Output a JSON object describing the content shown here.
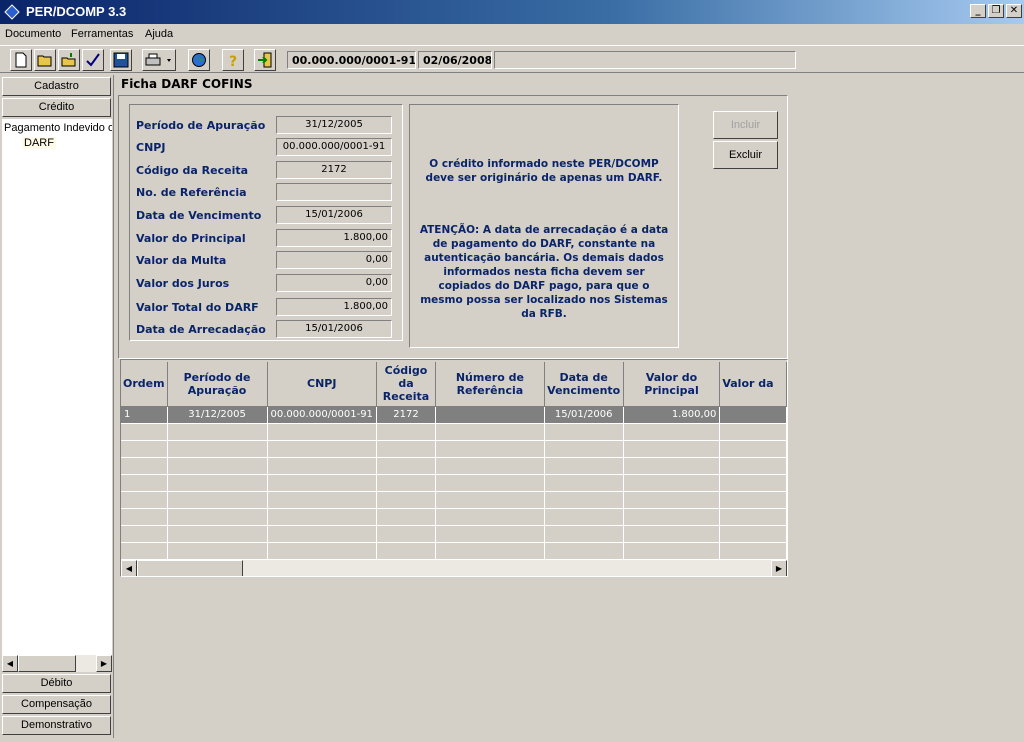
{
  "window": {
    "title": "PER/DCOMP 3.3",
    "min_label": "_",
    "restore_label": "❐",
    "close_label": "✕"
  },
  "menu": {
    "items": [
      "Documento",
      "Ferramentas",
      "Ajuda"
    ]
  },
  "toolbar": {
    "cnpj": "00.000.000/0001-91",
    "date": "02/06/2008",
    "status": ""
  },
  "sidebar": {
    "buttons_top": [
      "Cadastro",
      "Crédito"
    ],
    "tree_node": "Pagamento Indevido ou",
    "tree_child": "DARF",
    "buttons_bottom": [
      "Débito",
      "Compensação",
      "Demonstrativo"
    ]
  },
  "ficha": {
    "title": "Ficha DARF COFINS",
    "fields": [
      {
        "label": "Período de Apuração",
        "value": "31/12/2005",
        "align": "center"
      },
      {
        "label": "CNPJ",
        "value": "00.000.000/0001-91",
        "align": "center"
      },
      {
        "label": "Código da Receita",
        "value": "2172",
        "align": "center"
      },
      {
        "label": "No. de Referência",
        "value": "",
        "align": "center"
      },
      {
        "label": "Data de Vencimento",
        "value": "15/01/2006",
        "align": "center"
      },
      {
        "label": "Valor do Principal",
        "value": "1.800,00",
        "align": "right"
      },
      {
        "label": "Valor da Multa",
        "value": "0,00",
        "align": "right"
      },
      {
        "label": "Valor dos Juros",
        "value": "0,00",
        "align": "right"
      },
      {
        "label": "Valor Total do DARF",
        "value": "1.800,00",
        "align": "right"
      },
      {
        "label": "Data de Arrecadação",
        "value": "15/01/2006",
        "align": "center"
      }
    ],
    "info_1": "O crédito informado neste PER/DCOMP deve ser originário de apenas um DARF.",
    "info_2": "ATENÇÃO: A data de arrecadação é a data de pagamento do DARF, constante na autenticação bancária. Os demais dados informados nesta ficha devem ser copiados do DARF pago, para que o mesmo possa ser localizado nos Sistemas da RFB.",
    "btn_incluir": "Incluir",
    "btn_excluir": "Excluir"
  },
  "grid": {
    "columns": [
      "Ordem",
      "Período de Apuração",
      "CNPJ",
      "Código da Receita",
      "Número de Referência",
      "Data de Vencimento",
      "Valor do Principal",
      "Valor da"
    ],
    "rows": [
      [
        "1",
        "31/12/2005",
        "00.000.000/0001-91",
        "2172",
        "",
        "15/01/2006",
        "1.800,00",
        ""
      ]
    ],
    "empty_rows": 8
  }
}
